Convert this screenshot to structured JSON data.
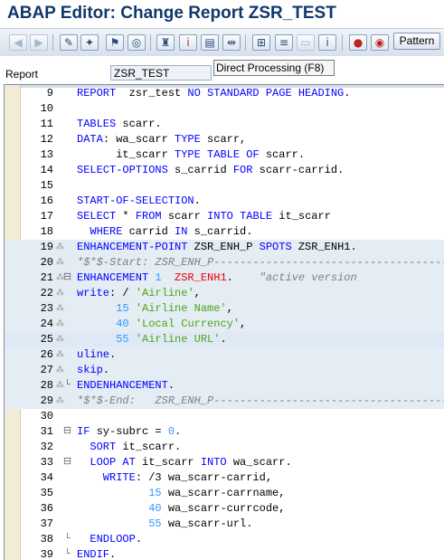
{
  "window": {
    "title": "ABAP Editor: Change Report ZSR_TEST"
  },
  "toolbar": {
    "icons": [
      "back-arrow-icon",
      "forward-arrow-icon",
      "display-change-icon",
      "check-icon",
      "activate-icon",
      "test-icon",
      "where-used-icon",
      "object-list-icon",
      "navigation-window-icon",
      "display-object-list-icon",
      "hierarchy-icon",
      "enhancement-icon",
      "info-icon",
      "breakpoint-icon",
      "session-breakpoint-icon"
    ],
    "pattern_label": "Pattern"
  },
  "field": {
    "label": "Report",
    "value": "ZSR_TEST"
  },
  "tooltip": {
    "text": "Direct Processing   (F8)"
  },
  "editor": {
    "lines": [
      {
        "n": "9",
        "segments": [
          {
            "c": "kw",
            "t": "REPORT  "
          },
          {
            "c": "plain",
            "t": "zsr_test "
          },
          {
            "c": "kw",
            "t": "NO STANDARD PAGE HEADING"
          },
          {
            "c": "plain",
            "t": "."
          }
        ]
      },
      {
        "n": "10",
        "segments": []
      },
      {
        "n": "11",
        "segments": [
          {
            "c": "kw",
            "t": "TABLES "
          },
          {
            "c": "plain",
            "t": "scarr."
          }
        ]
      },
      {
        "n": "12",
        "segments": [
          {
            "c": "kw",
            "t": "DATA"
          },
          {
            "c": "plain",
            "t": ": wa_scarr "
          },
          {
            "c": "kw",
            "t": "TYPE "
          },
          {
            "c": "plain",
            "t": "scarr,"
          }
        ]
      },
      {
        "n": "13",
        "segments": [
          {
            "c": "plain",
            "t": "      it_scarr "
          },
          {
            "c": "kw",
            "t": "TYPE TABLE OF "
          },
          {
            "c": "plain",
            "t": "scarr."
          }
        ]
      },
      {
        "n": "14",
        "segments": [
          {
            "c": "kw",
            "t": "SELECT-OPTIONS "
          },
          {
            "c": "plain",
            "t": "s_carrid "
          },
          {
            "c": "kw",
            "t": "FOR "
          },
          {
            "c": "plain",
            "t": "scarr-carrid."
          }
        ]
      },
      {
        "n": "15",
        "segments": []
      },
      {
        "n": "16",
        "segments": [
          {
            "c": "kw",
            "t": "START-OF-SELECTION"
          },
          {
            "c": "plain",
            "t": "."
          }
        ]
      },
      {
        "n": "17",
        "segments": [
          {
            "c": "kw",
            "t": "SELECT "
          },
          {
            "c": "plain",
            "t": "* "
          },
          {
            "c": "kw",
            "t": "FROM "
          },
          {
            "c": "plain",
            "t": "scarr "
          },
          {
            "c": "kw",
            "t": "INTO TABLE "
          },
          {
            "c": "plain",
            "t": "it_scarr"
          }
        ]
      },
      {
        "n": "18",
        "segments": [
          {
            "c": "kw",
            "t": "  WHERE "
          },
          {
            "c": "plain",
            "t": "carrid "
          },
          {
            "c": "kw",
            "t": "IN "
          },
          {
            "c": "plain",
            "t": "s_carrid."
          }
        ]
      },
      {
        "n": "19",
        "segments": [
          {
            "c": "kw",
            "t": "ENHANCEMENT-POINT "
          },
          {
            "c": "plain",
            "t": "ZSR_ENH_P "
          },
          {
            "c": "kw",
            "t": "SPOTS "
          },
          {
            "c": "plain",
            "t": "ZSR_ENH1."
          }
        ]
      },
      {
        "n": "20",
        "segments": [
          {
            "c": "com",
            "t": "*$*$-Start: ZSR_ENH_P----------------------------------------------"
          }
        ]
      },
      {
        "n": "21",
        "segments": [
          {
            "c": "kw",
            "t": "ENHANCEMENT "
          },
          {
            "c": "num",
            "t": "1  "
          },
          {
            "c": "enh",
            "t": "ZSR_ENH1"
          },
          {
            "c": "plain",
            "t": ".    "
          },
          {
            "c": "com",
            "t": "\"active version"
          }
        ]
      },
      {
        "n": "22",
        "segments": [
          {
            "c": "kw",
            "t": "write"
          },
          {
            "c": "plain",
            "t": ": / "
          },
          {
            "c": "str",
            "t": "'Airline'"
          },
          {
            "c": "plain",
            "t": ","
          }
        ]
      },
      {
        "n": "23",
        "segments": [
          {
            "c": "plain",
            "t": "      "
          },
          {
            "c": "num",
            "t": "15 "
          },
          {
            "c": "str",
            "t": "'Airline Name'"
          },
          {
            "c": "plain",
            "t": ","
          }
        ]
      },
      {
        "n": "24",
        "segments": [
          {
            "c": "plain",
            "t": "      "
          },
          {
            "c": "num",
            "t": "40 "
          },
          {
            "c": "str",
            "t": "'Local Currency'"
          },
          {
            "c": "plain",
            "t": ","
          }
        ]
      },
      {
        "n": "25",
        "segments": [
          {
            "c": "plain",
            "t": "      "
          },
          {
            "c": "num",
            "t": "55 "
          },
          {
            "c": "str",
            "t": "'Airline URL'"
          },
          {
            "c": "plain",
            "t": "."
          }
        ]
      },
      {
        "n": "26",
        "segments": [
          {
            "c": "kw",
            "t": "uline"
          },
          {
            "c": "plain",
            "t": "."
          }
        ]
      },
      {
        "n": "27",
        "segments": [
          {
            "c": "kw",
            "t": "skip"
          },
          {
            "c": "plain",
            "t": "."
          }
        ]
      },
      {
        "n": "28",
        "segments": [
          {
            "c": "kw",
            "t": "ENDENHANCEMENT"
          },
          {
            "c": "plain",
            "t": "."
          }
        ]
      },
      {
        "n": "29",
        "segments": [
          {
            "c": "com",
            "t": "*$*$-End:   ZSR_ENH_P----------------------------------------------"
          }
        ]
      },
      {
        "n": "30",
        "segments": []
      },
      {
        "n": "31",
        "segments": [
          {
            "c": "kw",
            "t": "IF "
          },
          {
            "c": "plain",
            "t": "sy-subrc = "
          },
          {
            "c": "num",
            "t": "0"
          },
          {
            "c": "plain",
            "t": "."
          }
        ]
      },
      {
        "n": "32",
        "segments": [
          {
            "c": "kw",
            "t": "  SORT "
          },
          {
            "c": "plain",
            "t": "it_scarr."
          }
        ]
      },
      {
        "n": "33",
        "segments": [
          {
            "c": "kw",
            "t": "  LOOP AT "
          },
          {
            "c": "plain",
            "t": "it_scarr "
          },
          {
            "c": "kw",
            "t": "INTO "
          },
          {
            "c": "plain",
            "t": "wa_scarr."
          }
        ]
      },
      {
        "n": "34",
        "segments": [
          {
            "c": "kw",
            "t": "    WRITE"
          },
          {
            "c": "plain",
            "t": ": /3 wa_scarr-carrid,"
          }
        ]
      },
      {
        "n": "35",
        "segments": [
          {
            "c": "plain",
            "t": "           "
          },
          {
            "c": "num",
            "t": "15 "
          },
          {
            "c": "plain",
            "t": "wa_scarr-carrname,"
          }
        ]
      },
      {
        "n": "36",
        "segments": [
          {
            "c": "plain",
            "t": "           "
          },
          {
            "c": "num",
            "t": "40 "
          },
          {
            "c": "plain",
            "t": "wa_scarr-currcode,"
          }
        ]
      },
      {
        "n": "37",
        "segments": [
          {
            "c": "plain",
            "t": "           "
          },
          {
            "c": "num",
            "t": "55 "
          },
          {
            "c": "plain",
            "t": "wa_scarr-url."
          }
        ]
      },
      {
        "n": "38",
        "segments": [
          {
            "c": "kw",
            "t": "  ENDLOOP"
          },
          {
            "c": "plain",
            "t": "."
          }
        ]
      },
      {
        "n": "39",
        "segments": [
          {
            "c": "kw",
            "t": "ENDIF"
          },
          {
            "c": "plain",
            "t": "."
          }
        ]
      }
    ]
  },
  "colors": {
    "keyword": "#0000ff",
    "string": "#4da619",
    "number": "#3399ff",
    "comment": "#808080",
    "enhancement_name": "#ee0000",
    "title": "#10386c"
  }
}
